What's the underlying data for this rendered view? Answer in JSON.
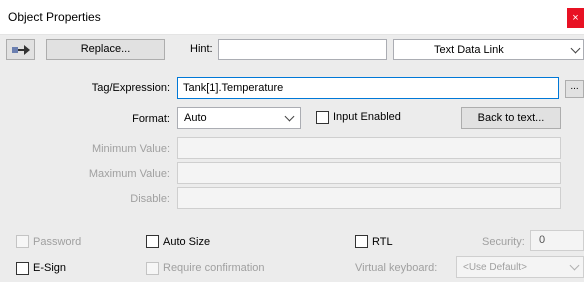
{
  "window": {
    "title": "Object Properties",
    "close_glyph": "×"
  },
  "toolbar": {
    "replace_label": "Replace...",
    "hint_label": "Hint:",
    "hint_value": "",
    "link_type": "Text Data Link"
  },
  "tag": {
    "label": "Tag/Expression:",
    "value": "Tank[1].Temperature",
    "browse_label": "..."
  },
  "format": {
    "label": "Format:",
    "value": "Auto",
    "input_enabled_label": "Input Enabled",
    "back_to_text_label": "Back to text..."
  },
  "fields": {
    "min_label": "Minimum Value:",
    "max_label": "Maximum Value:",
    "disable_label": "Disable:"
  },
  "options": {
    "password_label": "Password",
    "auto_size_label": "Auto Size",
    "rtl_label": "RTL",
    "security_label": "Security:",
    "security_value": "0",
    "esign_label": "E-Sign",
    "require_confirmation_label": "Require confirmation",
    "virtual_keyboard_label": "Virtual keyboard:",
    "virtual_keyboard_value": "<Use Default>"
  },
  "colors": {
    "close": "#e81123",
    "focus": "#0078d7",
    "panel": "#ececec"
  }
}
